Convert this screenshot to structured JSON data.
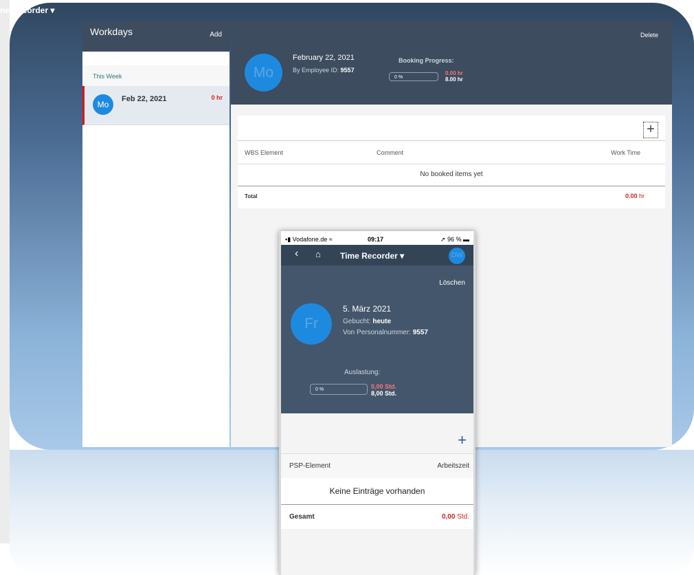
{
  "app_title": "ne Recorder ▾",
  "master": {
    "title": "Workdays",
    "add_label": "Add",
    "group": "This Week",
    "items": [
      {
        "avatar": "Mo",
        "date": "Feb 22, 2021",
        "hours": "0 hr"
      }
    ]
  },
  "detail": {
    "delete_label": "Delete",
    "avatar": "Mo",
    "date": "February 22, 2021",
    "employee_label": "By Employee ID:",
    "employee_id": "9557",
    "booking_label": "Booking Progress:",
    "progress_text": "0 %",
    "booked": "0.00 hr",
    "target": "8.00 hr",
    "add_icon": "plus-icon",
    "columns": [
      "WBS Element",
      "Comment",
      "Work Time"
    ],
    "empty_text": "No booked items yet",
    "total_label": "Total",
    "total_value": "0.00",
    "total_unit": "hr"
  },
  "phone": {
    "carrier": "Vodafone.de",
    "time": "09:17",
    "battery": "96 %",
    "title": "Time Recorder ▾",
    "avatar": "DW",
    "delete_label": "Löschen",
    "day_avatar": "Fr",
    "date": "5. März 2021",
    "booked_label": "Gebucht:",
    "booked_value": "heute",
    "personnel_label": "Von Personalnummer:",
    "personnel_value": "9557",
    "utilization_label": "Auslastung:",
    "progress_text": "0 %",
    "booked_hours": "0,00 Std.",
    "target_hours": "8,00 Std.",
    "columns": [
      "PSP-Element",
      "Arbeitszeit"
    ],
    "empty_text": "Keine Einträge vorhanden",
    "total_label": "Gesamt",
    "total_value": "0,00",
    "total_unit": "Std."
  },
  "colors": {
    "header": "#3d4c5e",
    "avatar": "#1d8ae0",
    "accent_red": "#c9251d",
    "group_text": "#2c7a72"
  }
}
